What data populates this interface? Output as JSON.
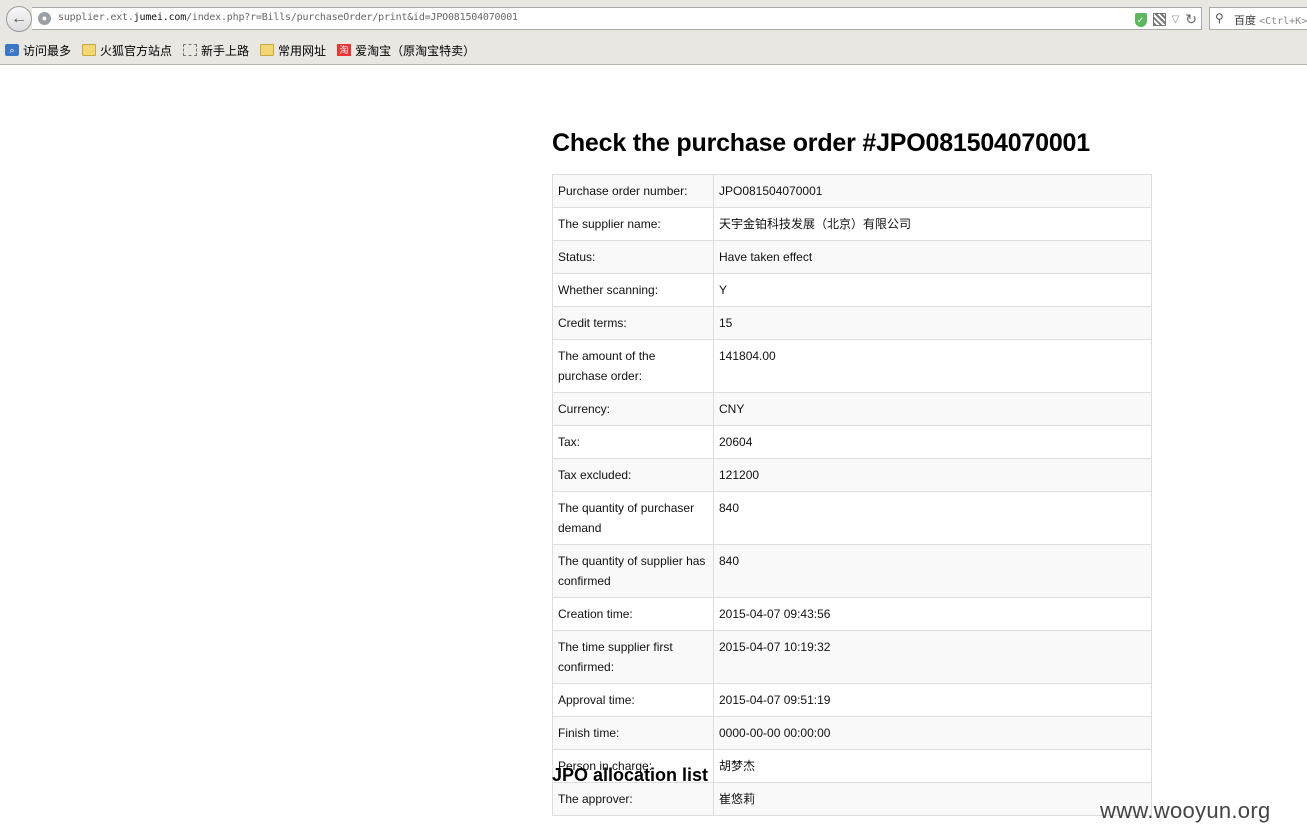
{
  "browser": {
    "url_prefix": "supplier.ext.",
    "url_domain": "jumei.com",
    "url_suffix": "/index.php?r=Bills/purchaseOrder/print&id=JPO081504070001",
    "search_engine": "百度",
    "search_shortcut": "<Ctrl+K>",
    "bookmarks": [
      "访问最多",
      "火狐官方站点",
      "新手上路",
      "常用网址",
      "爱淘宝（原淘宝特卖）"
    ]
  },
  "page": {
    "title": "Check the purchase order #JPO081504070001",
    "next_heading": "JPO allocation list"
  },
  "rows": [
    {
      "label": "Purchase order number:",
      "value": "JPO081504070001"
    },
    {
      "label": "The supplier name:",
      "value": "天宇金铂科技发展（北京）有限公司"
    },
    {
      "label": "Status:",
      "value": "Have taken effect"
    },
    {
      "label": "Whether scanning:",
      "value": "Y"
    },
    {
      "label": "Credit terms:",
      "value": "15"
    },
    {
      "label": "The amount of the purchase order:",
      "value": "141804.00"
    },
    {
      "label": "Currency:",
      "value": "CNY"
    },
    {
      "label": "Tax:",
      "value": "20604"
    },
    {
      "label": "Tax excluded:",
      "value": "121200"
    },
    {
      "label": "The quantity of purchaser demand",
      "value": "840"
    },
    {
      "label": "The quantity of supplier has confirmed",
      "value": "840"
    },
    {
      "label": "Creation time:",
      "value": "2015-04-07 09:43:56"
    },
    {
      "label": "The time supplier first confirmed:",
      "value": "2015-04-07 10:19:32"
    },
    {
      "label": "Approval time:",
      "value": "2015-04-07 09:51:19"
    },
    {
      "label": "Finish time:",
      "value": "0000-00-00 00:00:00"
    },
    {
      "label": "Person in charge:",
      "value": "胡梦杰"
    },
    {
      "label": "The approver:",
      "value": "崔悠莉"
    }
  ],
  "watermark": "www.wooyun.org",
  "icons": {
    "back": "arrow-left-icon",
    "site": "globe-icon",
    "shield": "shield-icon",
    "qr": "qr-code-icon",
    "reload": "reload-icon",
    "search": "search-icon"
  }
}
